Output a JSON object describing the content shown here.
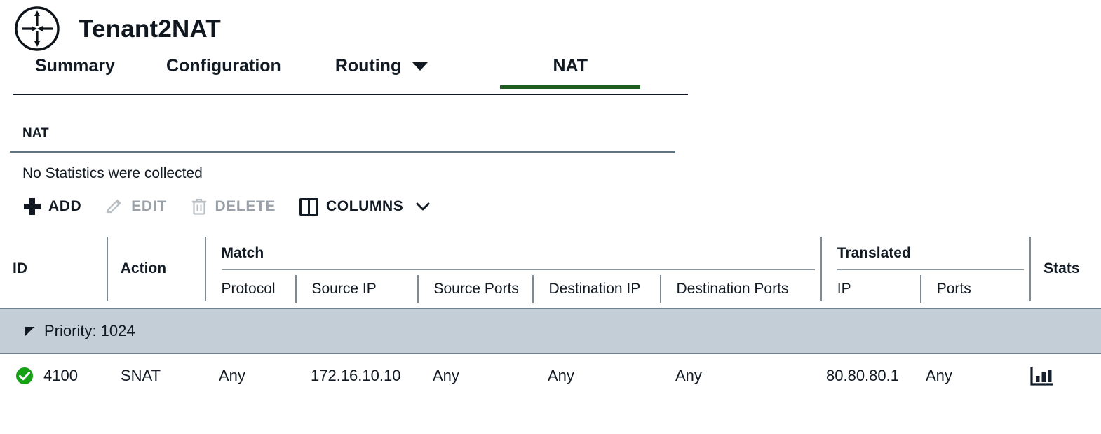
{
  "header": {
    "icon": "router-nat-icon",
    "title": "Tenant2NAT"
  },
  "tabs": [
    {
      "label": "Summary",
      "active": false,
      "has_caret": false
    },
    {
      "label": "Configuration",
      "active": false,
      "has_caret": false
    },
    {
      "label": "Routing",
      "active": false,
      "has_caret": true
    },
    {
      "label": "NAT",
      "active": true,
      "has_caret": false
    }
  ],
  "section": {
    "title": "NAT",
    "stats_note": "No Statistics were collected"
  },
  "toolbar": {
    "add_label": "ADD",
    "edit_label": "EDIT",
    "delete_label": "DELETE",
    "columns_label": "COLUMNS"
  },
  "table": {
    "columns": {
      "id": "ID",
      "action": "Action",
      "match_group": "Match",
      "match_protocol": "Protocol",
      "match_source_ip": "Source IP",
      "match_source_ports": "Source Ports",
      "match_destination_ip": "Destination IP",
      "match_destination_ports": "Destination Ports",
      "translated_group": "Translated",
      "translated_ip": "IP",
      "translated_ports": "Ports",
      "stats": "Stats"
    },
    "group_row": {
      "label": "Priority: 1024",
      "expanded": true
    },
    "rows": [
      {
        "status": "enabled",
        "id": "4100",
        "action": "SNAT",
        "protocol": "Any",
        "source_ip": "172.16.10.10",
        "source_ports": "Any",
        "destination_ip": "Any",
        "destination_ports": "Any",
        "translated_ip": "80.80.80.1",
        "translated_ports": "Any",
        "stats_icon": "bar-chart-icon"
      }
    ]
  },
  "colors": {
    "active_tab_underline": "#1d5e20",
    "status_enabled": "#16a016",
    "group_row_bg": "#c3ced6",
    "divider": "#7d8a93"
  }
}
